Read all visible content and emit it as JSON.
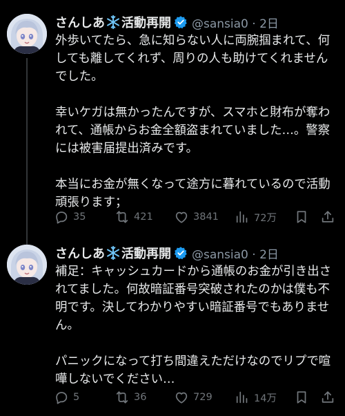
{
  "tweets": [
    {
      "author_name": "さんしあ",
      "author_suffix": "活動再開",
      "handle_date": "@sansia0 · 2日",
      "body": "外歩いてたら、急に知らない人に両腕掴まれて、何しても離してくれず、周りの人も助けてくれませんでした。\n\n幸いケガは無かったんですが、スマホと財布が奪われて、通帳からお金全額盗まれていました…。警察には被害届提出済みです。\n\n本当にお金が無くなって途方に暮れているので活動頑張ります；",
      "stats": {
        "replies": "35",
        "retweets": "421",
        "likes": "3841",
        "views": "72万"
      }
    },
    {
      "author_name": "さんしあ",
      "author_suffix": "活動再開",
      "handle_date": "@sansia0 · 2日",
      "body": "補足：キャッシュカードから通帳のお金が引き出されてました。何故暗証番号突破されたのかは僕も不明です。決してわかりやすい暗証番号でもありません。\n\nパニックになって打ち間違えただけなのでリプで喧嘩しないでください…",
      "stats": {
        "replies": "5",
        "retweets": "36",
        "likes": "729",
        "views": "14万"
      }
    }
  ],
  "icons": {
    "snowflake": "snowflake-icon",
    "verified": "verified-badge-icon",
    "reply": "reply-icon",
    "retweet": "retweet-icon",
    "like": "heart-icon",
    "views": "views-icon",
    "bookmark": "bookmark-icon",
    "share": "share-icon"
  },
  "colors": {
    "background": "#000000",
    "text": "#e7e9ea",
    "secondary": "#71767b",
    "verified": "#1d9bf0",
    "snowflake": "#6ec3f5"
  }
}
